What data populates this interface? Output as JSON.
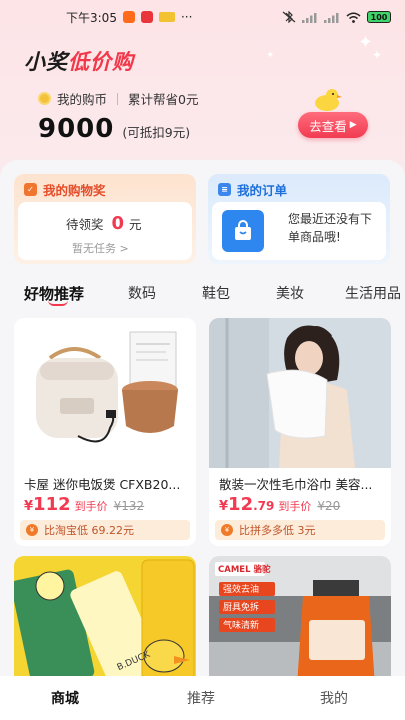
{
  "status_bar": {
    "time": "下午3:05",
    "battery": "100",
    "app_icon_label": "美团"
  },
  "header": {
    "brand_part1": "小奖",
    "brand_part2": "低价购",
    "coin_label": "我的购币",
    "saved_label": "累计帮省0元",
    "balance": "9000",
    "balance_note": "(可抵扣9元)",
    "go_button": "去查看"
  },
  "award_card": {
    "title": "我的购物奖",
    "pending_label": "待领奖",
    "pending_value": "0",
    "pending_unit": "元",
    "task_text": "暂无任务 >"
  },
  "order_card": {
    "title": "我的订单",
    "empty_text": "您最近还没有下单商品哦!"
  },
  "tabs": [
    "好物推荐",
    "数码",
    "鞋包",
    "美妆",
    "生活用品"
  ],
  "products": [
    {
      "name": "卡屋 迷你电饭煲 CFXB20...",
      "price_int": "112",
      "price_dec": "",
      "price_note": "到手价",
      "orig_price": "¥132",
      "save_text": "比淘宝低 69.22元"
    },
    {
      "name": "散装一次性毛巾浴巾 美容...",
      "price_int": "12",
      "price_dec": ".79",
      "price_note": "到手价",
      "orig_price": "¥20",
      "save_text": "比拼多多低 3元"
    },
    {
      "name": "",
      "image_text": "B.DUCK"
    },
    {
      "name": "",
      "image_brand": "CAMEL 骆驼",
      "image_tags": [
        "强效去油",
        "厨具免拆",
        "气味清新"
      ]
    }
  ],
  "bottom_nav": [
    "商城",
    "推荐",
    "我的"
  ],
  "currency": "¥",
  "colors": {
    "accent": "#f2384b",
    "order_blue": "#2e86ef",
    "award_orange": "#f0762f"
  }
}
